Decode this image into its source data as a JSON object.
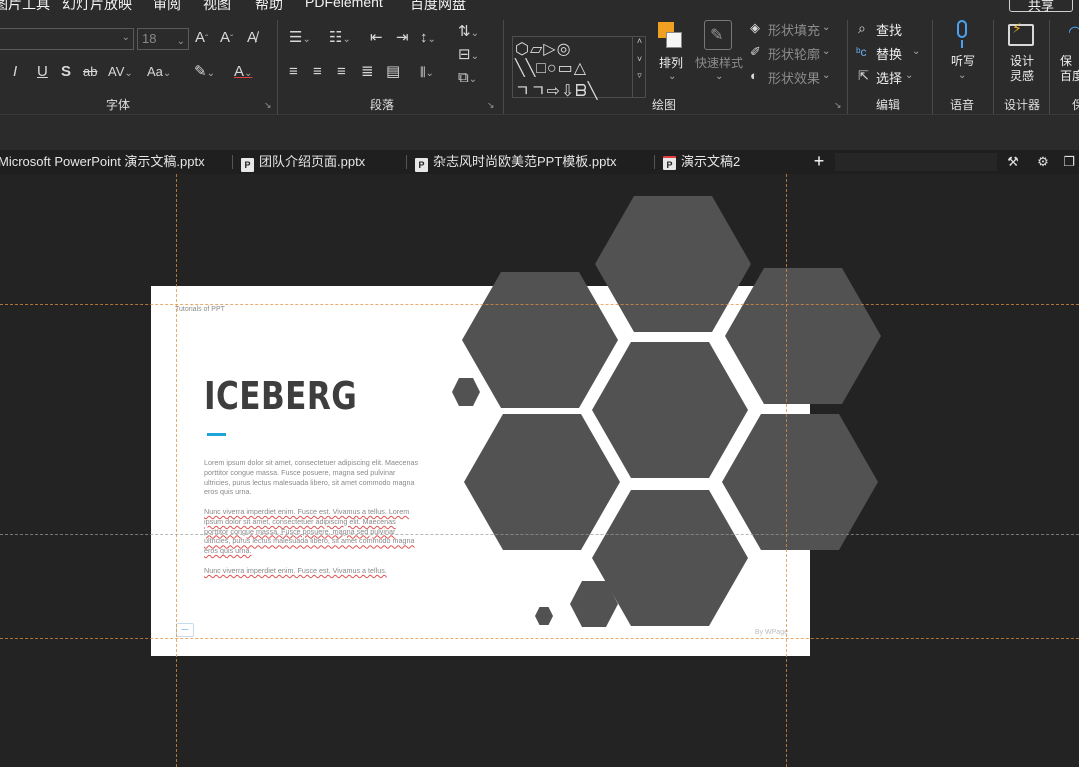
{
  "menu": {
    "items": [
      "图片工具",
      "幻灯片放映",
      "审阅",
      "视图",
      "帮助",
      "PDFelement",
      "百度网盘"
    ],
    "share_label": "共享"
  },
  "ribbon": {
    "font": {
      "name_value": "",
      "size_value": "18",
      "group_label": "字体"
    },
    "paragraph": {
      "group_label": "段落"
    },
    "drawing": {
      "group_label": "绘图",
      "shape_rows": [
        "⬡▱▷◎",
        "╲╲□○▭△",
        "ㄱㄱ⇨⇩ᗷ╲"
      ],
      "arrange_label": "排列",
      "quick_styles_label": "快速样式",
      "shape_fill_label": "形状填充",
      "shape_outline_label": "形状轮廓",
      "shape_effects_label": "形状效果"
    },
    "editing": {
      "group_label": "编辑",
      "find_label": "查找",
      "replace_label": "替换",
      "select_label": "选择"
    },
    "voice": {
      "group_label": "语音",
      "dictate_label": "听写"
    },
    "designer": {
      "group_label": "设计器",
      "design_ideas_line1": "设计",
      "design_ideas_line2": "灵感"
    },
    "extra": {
      "label_line1": "保",
      "label_line2": "百度",
      "group_label": "保"
    }
  },
  "tabs": [
    {
      "label": "Microsoft PowerPoint 演示文稿.pptx",
      "active": false
    },
    {
      "label": "团队介绍页面.pptx",
      "active": false
    },
    {
      "label": "杂志风时尚欧美范PPT模板.pptx",
      "active": false
    },
    {
      "label": "演示文稿2",
      "active": true
    }
  ],
  "slide": {
    "corner_text": "Tutorials of PPT",
    "title": "ICEBERG",
    "accent_color": "#1ea4d8",
    "paragraph1": "Lorem ipsum dolor sit amet, consectetuer adipiscing elit. Maecenas porttitor congue massa. Fusce posuere, magna sed pulvinar ultricies, purus lectus malesuada libero, sit amet commodo magna eros quis urna.",
    "paragraph2": "Nunc viverra imperdiet enim. Fusce est. Vivamus a tellus. Lorem ipsum dolor sit amet, consectetuer adipiscing elit. Maecenas porttitor congue massa. Fusce posuere, magna sed pulvinar ultricies, purus lectus malesuada libero, sit amet commodo magna eros quis urna.",
    "paragraph3": "Nunc viverra imperdiet enim. Fusce est. Vivamus a tellus.",
    "footer_text": "By WPage",
    "hex_color": "#525252"
  }
}
